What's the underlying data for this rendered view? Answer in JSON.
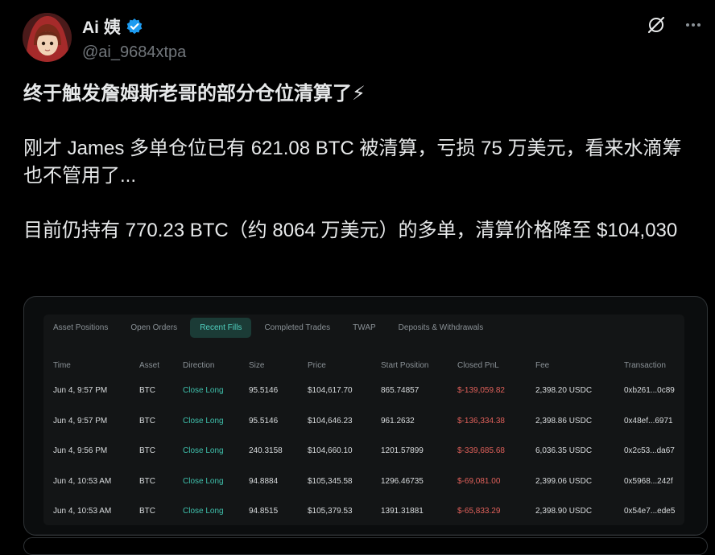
{
  "author": {
    "display_name": "Ai 姨",
    "handle": "@ai_9684xtpa"
  },
  "tweet": {
    "title": "终于触发詹姆斯老哥的部分仓位清算了⚡",
    "paragraph1": "刚才 James 多单仓位已有 621.08 BTC 被清算，亏损 75 万美元，看来水滴筹也不管用了...",
    "paragraph2": "目前仍持有 770.23 BTC（约 8064 万美元）的多单，清算价格降至 $104,030"
  },
  "card": {
    "tabs": [
      {
        "label": "Asset Positions",
        "active": false
      },
      {
        "label": "Open Orders",
        "active": false
      },
      {
        "label": "Recent Fills",
        "active": true
      },
      {
        "label": "Completed Trades",
        "active": false
      },
      {
        "label": "TWAP",
        "active": false
      },
      {
        "label": "Deposits & Withdrawals",
        "active": false
      }
    ],
    "columns": [
      "Time",
      "Asset",
      "Direction",
      "Size",
      "Price",
      "Start Position",
      "Closed PnL",
      "Fee",
      "Transaction"
    ],
    "rows": [
      [
        "Jun 4, 9:57 PM",
        "BTC",
        "Close Long",
        "95.5146",
        "$104,617.70",
        "865.74857",
        "$-139,059.82",
        "2,398.20 USDC",
        "0xb261...0c89"
      ],
      [
        "Jun 4, 9:57 PM",
        "BTC",
        "Close Long",
        "95.5146",
        "$104,646.23",
        "961.2632",
        "$-136,334.38",
        "2,398.86 USDC",
        "0x48ef...6971"
      ],
      [
        "Jun 4, 9:56 PM",
        "BTC",
        "Close Long",
        "240.3158",
        "$104,660.10",
        "1201.57899",
        "$-339,685.68",
        "6,036.35 USDC",
        "0x2c53...da67"
      ],
      [
        "Jun 4, 10:53 AM",
        "BTC",
        "Close Long",
        "94.8884",
        "$105,345.58",
        "1296.46735",
        "$-69,081.00",
        "2,399.06 USDC",
        "0x5968...242f"
      ],
      [
        "Jun 4, 10:53 AM",
        "BTC",
        "Close Long",
        "94.8515",
        "$105,379.53",
        "1391.31881",
        "$-65,833.29",
        "2,398.90 USDC",
        "0x54e7...ede5"
      ]
    ]
  },
  "colors": {
    "accent_teal": "#3fc0ac",
    "negative_red": "#e0605a",
    "verified_blue": "#1d9bf0"
  }
}
